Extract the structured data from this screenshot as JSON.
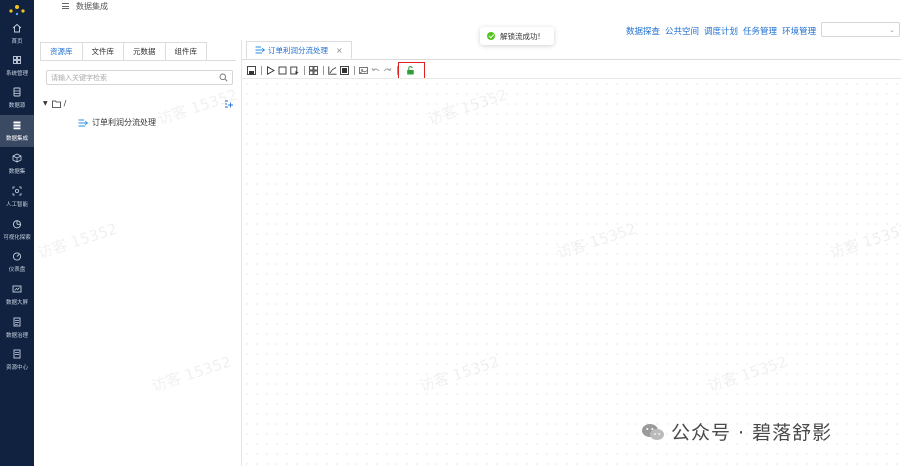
{
  "breadcrumb": {
    "current": "数据集成"
  },
  "nav": {
    "items": [
      {
        "label": "首页",
        "icon": "home-icon",
        "active": false
      },
      {
        "label": "系统管理",
        "icon": "grid-icon",
        "active": false
      },
      {
        "label": "数据源",
        "icon": "database-icon",
        "active": false
      },
      {
        "label": "数据集成",
        "icon": "stack-icon",
        "active": true
      },
      {
        "label": "数据集",
        "icon": "cube-icon",
        "active": false
      },
      {
        "label": "人工智能",
        "icon": "ai-icon",
        "active": false
      },
      {
        "label": "可视化探索",
        "icon": "pie-icon",
        "active": false
      },
      {
        "label": "仪表盘",
        "icon": "gauge-icon",
        "active": false
      },
      {
        "label": "数据大屏",
        "icon": "screen-icon",
        "active": false
      },
      {
        "label": "数据治理",
        "icon": "document-icon",
        "active": false
      },
      {
        "label": "资源中心",
        "icon": "folder-icon",
        "active": false
      }
    ]
  },
  "topmenu": {
    "items": [
      "数据探查",
      "公共空间",
      "调度计划",
      "任务管理",
      "环境管理"
    ]
  },
  "topselect": {
    "value": ""
  },
  "toast": {
    "message": "解锁流成功!",
    "color": "#52c41a"
  },
  "panel": {
    "tabs": [
      {
        "label": "资源库",
        "active": true
      },
      {
        "label": "文件库",
        "active": false
      },
      {
        "label": "元数据",
        "active": false
      },
      {
        "label": "组件库",
        "active": false
      }
    ],
    "search_placeholder": "请输入关键字检索",
    "tree": {
      "root": "/",
      "children": [
        "订单利润分流处理"
      ]
    }
  },
  "editor": {
    "tab_label": "订单利润分流处理",
    "toolbar": [
      "save-icon",
      "run-icon",
      "stop-icon",
      "debug-icon",
      "layout-icon",
      "chart-icon",
      "image-icon",
      "picture-icon",
      "undo-icon",
      "redo-icon",
      "unlock-icon"
    ]
  },
  "watermark": "访客 15352",
  "brand": "公众号 · 碧落舒影",
  "colors": {
    "nav_bg": "#10223f",
    "accent": "#1f6fd1",
    "highlight": "#e02020",
    "unlock": "#2e9d3a"
  }
}
